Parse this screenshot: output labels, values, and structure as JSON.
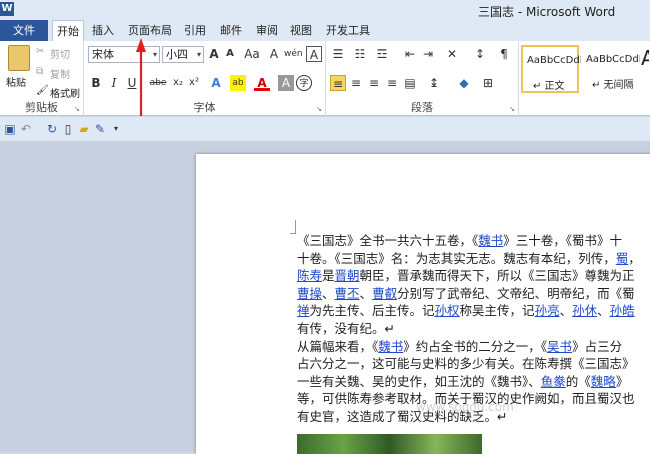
{
  "app": {
    "title": "三国志 - Microsoft Word",
    "icon": "word-icon"
  },
  "tabs": [
    "文件",
    "开始",
    "插入",
    "页面布局",
    "引用",
    "邮件",
    "审阅",
    "视图",
    "开发工具"
  ],
  "active_tab": "开始",
  "ribbon": {
    "clipboard": {
      "label": "剪贴板",
      "paste": "粘贴",
      "cut": "剪切",
      "copy": "复制",
      "format_painter": "格式刷"
    },
    "font": {
      "label": "字体",
      "font_name": "宋体",
      "font_size": "小四",
      "bold": "B",
      "italic": "I",
      "underline": "U",
      "strike": "abe",
      "sub": "x₂",
      "sup": "x²",
      "grow": "A",
      "shrink": "A",
      "case": "Aa",
      "clear": "A",
      "phonetic": "wén",
      "border": "A",
      "effect": "A",
      "highlight": "ab",
      "color": "A",
      "shading": "A",
      "enclose": "字"
    },
    "paragraph": {
      "label": "段落"
    },
    "styles": [
      {
        "sample": "AaBbCcDdI",
        "name": "↵ 正文"
      },
      {
        "sample": "AaBbCcDdI",
        "name": "↵ 无间隔"
      },
      {
        "sample": "A",
        "name": ""
      }
    ]
  },
  "qat": {
    "save": "save-icon",
    "undo": "undo-icon",
    "redo": "redo-icon"
  },
  "document": {
    "lines": [
      [
        {
          "t": "《三国志》全书一共六十五卷，《"
        },
        {
          "t": "魏书",
          "l": true
        },
        {
          "t": "》三十卷，《蜀书》十"
        }
      ],
      [
        {
          "t": "十卷。《三国志》名：为志其实无志。魏志有本纪，列传，"
        },
        {
          "t": "蜀",
          "l": true
        },
        {
          "t": "，"
        }
      ],
      [
        {
          "t": "陈寿",
          "l": true
        },
        {
          "t": "是"
        },
        {
          "t": "晋朝",
          "l": true
        },
        {
          "t": "朝臣，晋承魏而得天下，所以《三国志》尊魏为正"
        }
      ],
      [
        {
          "t": "曹操",
          "l": true
        },
        {
          "t": "、"
        },
        {
          "t": "曹丕",
          "l": true
        },
        {
          "t": "、"
        },
        {
          "t": "曹叡",
          "l": true
        },
        {
          "t": "分别写了武帝纪、文帝纪、明帝纪，而《蜀"
        }
      ],
      [
        {
          "t": "禅",
          "l": true
        },
        {
          "t": "为先主传、后主传。记"
        },
        {
          "t": "孙权",
          "l": true
        },
        {
          "t": "称吴主传，记"
        },
        {
          "t": "孙亮",
          "l": true
        },
        {
          "t": "、"
        },
        {
          "t": "孙休",
          "l": true
        },
        {
          "t": "、"
        },
        {
          "t": "孙皓",
          "l": true
        }
      ],
      [
        {
          "t": "有传，没有纪。↵"
        }
      ],
      [
        {
          "t": "从篇幅来看，《"
        },
        {
          "t": "魏书",
          "l": true
        },
        {
          "t": "》约占全书的二分之一，《"
        },
        {
          "t": "吴书",
          "l": true
        },
        {
          "t": "》占三分"
        }
      ],
      [
        {
          "t": "占六分之一，这可能与史料的多少有关。在陈寿撰《三国志》"
        }
      ],
      [
        {
          "t": "一些有关魏、吴的史作，如王沈的《魏书》、"
        },
        {
          "t": "鱼豢",
          "l": true
        },
        {
          "t": "的《"
        },
        {
          "t": "魏略",
          "l": true
        },
        {
          "t": "》"
        }
      ],
      [
        {
          "t": "等，可供陈寿参考取材。而关于蜀汉的史作阙如，而且蜀汉也"
        }
      ],
      [
        {
          "t": "有史官，这造成了蜀汉史料的缺乏。↵"
        }
      ]
    ],
    "watermark": "www.sogou.com"
  }
}
